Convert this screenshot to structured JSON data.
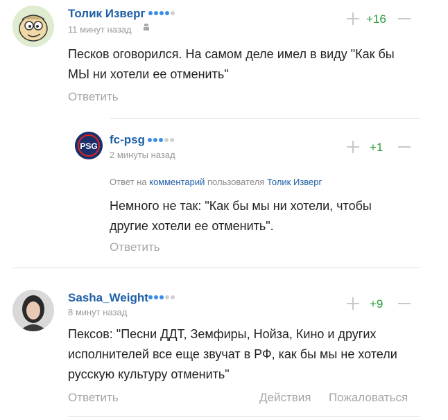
{
  "comments": [
    {
      "author": "Толик Изверг",
      "rating_dots": 4,
      "time": "11 минут назад",
      "device_icon": "android-icon",
      "score": "+16",
      "text_lines": [
        "Песков оговорился. На самом деле имел в виду \"Как бы",
        "МЫ ни хотели ее отменить\""
      ],
      "reply_label": "Ответить"
    },
    {
      "author": "fc-psg",
      "rating_dots": 3,
      "time": "2 минуты назад",
      "score": "+1",
      "reply_meta": {
        "prefix": "Ответ на",
        "link": "комментарий",
        "middle": "пользователя",
        "user": "Толик Изверг"
      },
      "text_lines": [
        "Немного не так: \"Как бы мы ни хотели, чтобы",
        "другие хотели ее отменить\"."
      ],
      "reply_label": "Ответить"
    },
    {
      "author": "Sasha_Weight",
      "rating_dots": 3,
      "time": "8 минут назад",
      "score": "+9",
      "text_lines": [
        "Пексов: \"Песни ДДТ, Земфиры, Нойза, Кино и других",
        "исполнителей все еще звучат в РФ, как бы мы не хотели",
        "русскую культуру отменить\""
      ],
      "reply_label": "Ответить",
      "actions_label": "Действия",
      "report_label": "Пожаловаться"
    }
  ],
  "colors": {
    "author": "#1f5fa6",
    "score": "#2a9d3a",
    "dot_on": "#3a8ee6",
    "dot_off": "#d0d0d0"
  }
}
